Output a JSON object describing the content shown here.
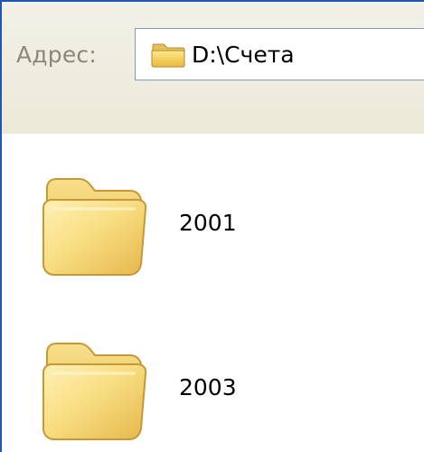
{
  "address_bar": {
    "label": "Адрес:",
    "path": "D:\\Счета",
    "icon": "folder-icon"
  },
  "folders": [
    {
      "name": "2001",
      "icon": "folder-icon"
    },
    {
      "name": "2003",
      "icon": "folder-icon"
    }
  ],
  "colors": {
    "window_border": "#1f57b8",
    "toolbar_background": "#ece9d8",
    "address_border": "#7f9db9",
    "folder_yellow": "#f4d873"
  }
}
